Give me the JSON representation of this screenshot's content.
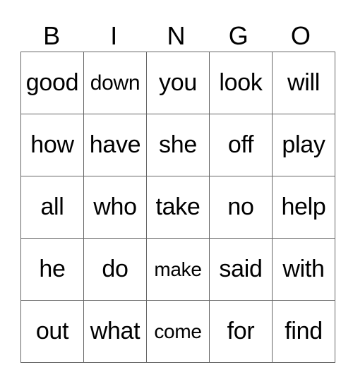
{
  "header": [
    "B",
    "I",
    "N",
    "G",
    "O"
  ],
  "rows": [
    [
      "good",
      "down",
      "you",
      "look",
      "will"
    ],
    [
      "how",
      "have",
      "she",
      "off",
      "play"
    ],
    [
      "all",
      "who",
      "take",
      "no",
      "help"
    ],
    [
      "he",
      "do",
      "make",
      "said",
      "with"
    ],
    [
      "out",
      "what",
      "come",
      "for",
      "find"
    ]
  ]
}
